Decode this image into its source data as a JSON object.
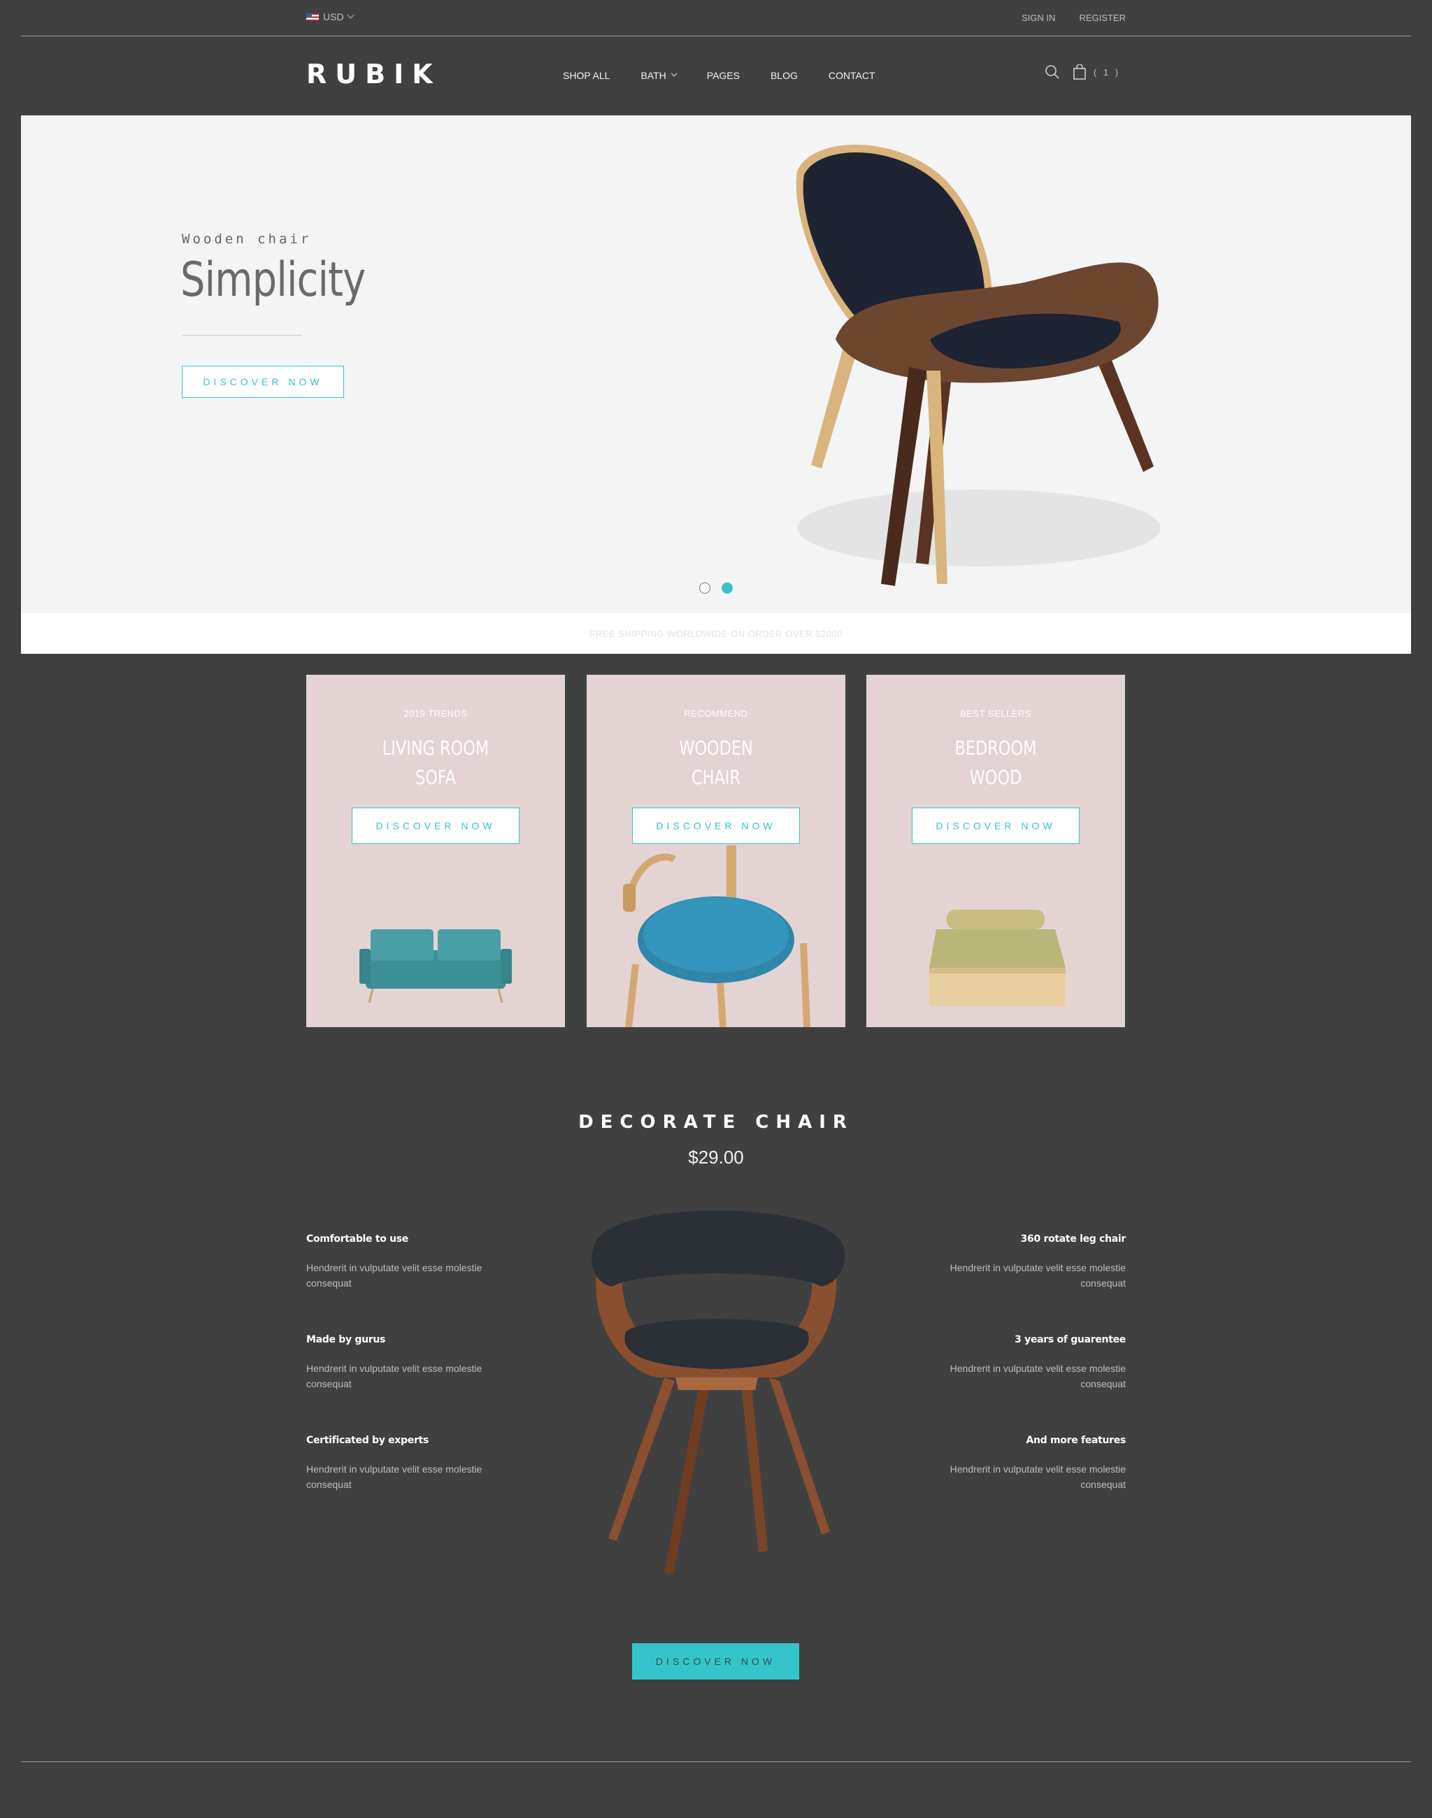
{
  "topbar": {
    "currency": "USD",
    "sign_in": "SIGN IN",
    "register": "REGISTER"
  },
  "header": {
    "logo": "RUBIK",
    "nav": [
      "SHOP ALL",
      "BATH",
      "PAGES",
      "BLOG",
      "CONTACT"
    ],
    "cart_count": "( 1 )"
  },
  "hero": {
    "subtitle": "Wooden chair",
    "title": "Simplicity",
    "button": "DISCOVER NOW",
    "slides": 2,
    "active_slide": 2
  },
  "shipping_notice": "FREE SHIPPING WORLDWIDE ON ORDER OVER $2000",
  "cards": [
    {
      "kicker": "2019 TRENDS",
      "title_line1": "LIVING ROOM",
      "title_line2": "SOFA",
      "button": "DISCOVER NOW"
    },
    {
      "kicker": "RECOMMEND",
      "title_line1": "WOODEN",
      "title_line2": "CHAIR",
      "button": "DISCOVER NOW"
    },
    {
      "kicker": "BEST SELLERS",
      "title_line1": "BEDROOM",
      "title_line2": "WOOD",
      "button": "DISCOVER NOW"
    }
  ],
  "product": {
    "title": "DECORATE CHAIR",
    "price": "$29.00",
    "features_left": [
      {
        "title": "Comfortable to use",
        "text": "Hendrerit in vulputate velit esse molestie consequat"
      },
      {
        "title": "Made by gurus",
        "text": "Hendrerit in vulputate velit esse molestie consequat"
      },
      {
        "title": "Certificated by experts",
        "text": "Hendrerit in vulputate velit esse molestie consequat"
      }
    ],
    "features_right": [
      {
        "title": "360 rotate leg chair",
        "text": "Hendrerit in vulputate velit esse molestie consequat"
      },
      {
        "title": "3 years of guarentee",
        "text": "Hendrerit in vulputate velit esse molestie consequat"
      },
      {
        "title": "And more features",
        "text": "Hendrerit in vulputate velit esse molestie consequat"
      }
    ],
    "button": "DISCOVER NOW"
  },
  "colors": {
    "accent": "#36c4cc",
    "background": "#404040",
    "card": "#e4d3d3"
  }
}
